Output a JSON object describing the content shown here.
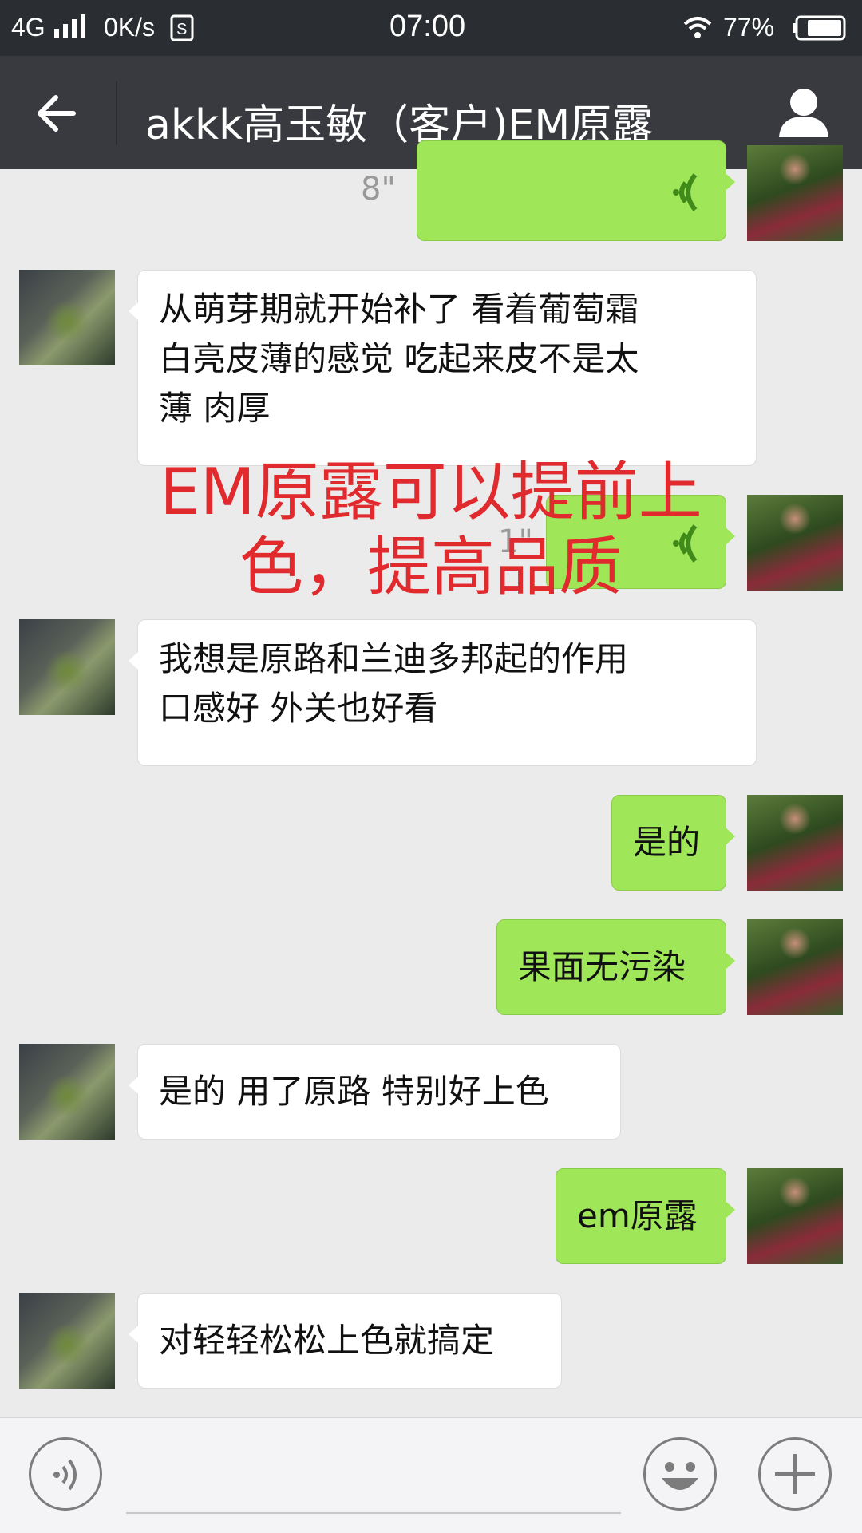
{
  "status_bar": {
    "network": "4G",
    "speed": "0K/s",
    "time": "07:00",
    "battery": "77%"
  },
  "header": {
    "title": "akkk高玉敏（客户)EM原露",
    "back_icon": "arrow-left-icon",
    "profile_icon": "user-icon"
  },
  "messages": [
    {
      "side": "out",
      "type": "voice",
      "duration": "8\""
    },
    {
      "side": "in",
      "type": "text",
      "lines": [
        "从萌芽期就开始补了 看着葡萄霜",
        "白亮皮薄的感觉 吃起来皮不是太",
        "薄 肉厚"
      ]
    },
    {
      "side": "out",
      "type": "voice",
      "duration": "1\""
    },
    {
      "side": "in",
      "type": "text",
      "lines": [
        "我想是原路和兰迪多邦起的作用",
        "口感好 外关也好看"
      ]
    },
    {
      "side": "out",
      "type": "text",
      "lines": [
        "是的"
      ]
    },
    {
      "side": "out",
      "type": "text",
      "lines": [
        "果面无污染"
      ]
    },
    {
      "side": "in",
      "type": "text",
      "lines": [
        "是的 用了原路 特别好上色"
      ]
    },
    {
      "side": "out",
      "type": "text",
      "lines": [
        "em原露"
      ]
    },
    {
      "side": "in",
      "type": "text",
      "lines": [
        "对轻轻松松上色就搞定"
      ]
    }
  ],
  "overlay": {
    "lines": [
      "EM原露可以提前上",
      "色，提高品质"
    ],
    "color": "#e02a2e"
  },
  "input_bar": {
    "voice_icon": "voice-icon",
    "emoji_icon": "emoji-icon",
    "plus_icon": "plus-icon"
  },
  "colors": {
    "status_bg": "#2a2d31",
    "header_bg": "#393a3f",
    "chat_bg": "#ebebeb",
    "out_bubble": "#9fe658",
    "in_bubble": "#ffffff"
  }
}
